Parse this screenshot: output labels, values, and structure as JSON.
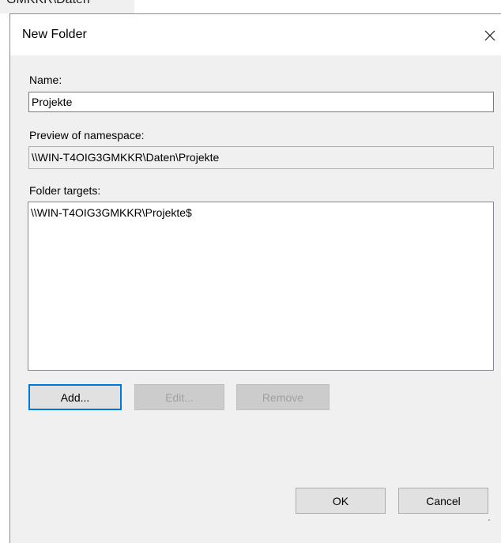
{
  "background_window": {
    "path_fragment": "GMKKR\\Daten"
  },
  "dialog": {
    "title": "New Folder",
    "close_glyph": "✕"
  },
  "name": {
    "label": "Name:",
    "value": "Projekte"
  },
  "preview": {
    "label": "Preview of namespace:",
    "value": "\\\\WIN-T4OIG3GMKKR\\Daten\\Projekte"
  },
  "folder_targets": {
    "label": "Folder targets:",
    "items": [
      "\\\\WIN-T4OIG3GMKKR\\Projekte$"
    ]
  },
  "buttons": {
    "add": "Add...",
    "edit": "Edit...",
    "remove": "Remove",
    "ok": "OK",
    "cancel": "Cancel"
  },
  "colors": {
    "dialog_background": "#f0f0f0",
    "titlebar_background": "#ffffff",
    "default_button_border": "#0078d7",
    "disabled_text": "#a0a0a0"
  }
}
